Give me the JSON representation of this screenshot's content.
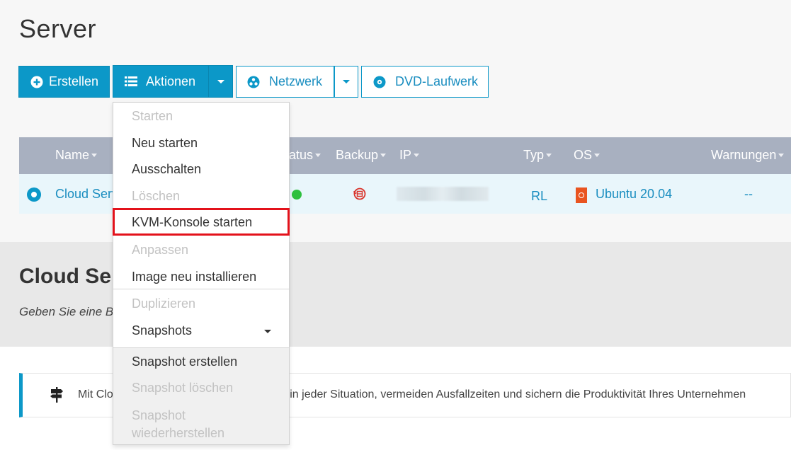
{
  "page": {
    "title": "Server"
  },
  "toolbar": {
    "create_label": "Erstellen",
    "actions_label": "Aktionen",
    "network_label": "Netzwerk",
    "dvd_label": "DVD-Laufwerk"
  },
  "table": {
    "columns": [
      "Name",
      "Status",
      "Backup",
      "IP",
      "Typ",
      "OS",
      "Warnungen"
    ],
    "status_partial": "atus",
    "row": {
      "name": "Cloud Serv",
      "typ": "RL",
      "os": "Ubuntu 20.04",
      "warnings": "--",
      "status_color": "#2ec03e"
    }
  },
  "section": {
    "title": "Cloud Ser",
    "subtitle": "Geben Sie eine B"
  },
  "info": {
    "text_left": "Mit Clo",
    "text_right": "en in jeder Situation, vermeiden Ausfallzeiten und sichern die Produktivität Ihres Unternehmen"
  },
  "actions_menu": {
    "items": [
      {
        "label": "Starten",
        "disabled": true
      },
      {
        "label": "Neu starten",
        "disabled": false
      },
      {
        "label": "Ausschalten",
        "disabled": false
      },
      {
        "label": "Löschen",
        "disabled": true
      },
      {
        "label": "KVM-Konsole starten",
        "disabled": false,
        "highlighted": true
      },
      {
        "label": "Anpassen",
        "disabled": true
      },
      {
        "label": "Image neu installieren",
        "disabled": false
      },
      {
        "label": "Duplizieren",
        "disabled": true
      },
      {
        "label": "Snapshots",
        "disabled": false,
        "submenu": true
      },
      {
        "label": "Snapshot erstellen",
        "disabled": false
      },
      {
        "label": "Snapshot löschen",
        "disabled": true
      },
      {
        "label": "Snapshot wiederherstellen",
        "disabled": true
      }
    ]
  },
  "colors": {
    "accent": "#0c98c8",
    "highlight_border": "#e3121b",
    "table_header": "#a8b0c0",
    "row_bg": "#e9f6fb"
  }
}
